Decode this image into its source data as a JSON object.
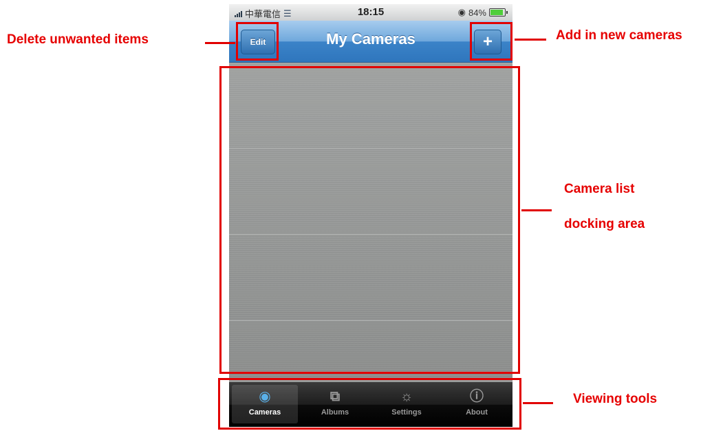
{
  "statusbar": {
    "carrier": "中華電信",
    "time": "18:15",
    "battery": "84%",
    "battery_level": 0.84
  },
  "navbar": {
    "title": "My Cameras",
    "edit_label": "Edit",
    "add_label": "+"
  },
  "tabbar": {
    "tabs": [
      {
        "label": "Cameras",
        "icon": "camera-icon",
        "active": true
      },
      {
        "label": "Albums",
        "icon": "albums-icon",
        "active": false
      },
      {
        "label": "Settings",
        "icon": "gears-icon",
        "active": false
      },
      {
        "label": "About",
        "icon": "info-icon",
        "active": false
      }
    ]
  },
  "annotations": {
    "edit_callout": "Delete unwanted items",
    "add_callout": "Add in new cameras",
    "list_callout_line1": "Camera list",
    "list_callout_line2": "docking area",
    "tools_callout": "Viewing tools"
  },
  "colors": {
    "annotation_red": "#e10000",
    "navbar_blue": "#3b83c8",
    "active_tab_icon": "#5ab0e8"
  }
}
